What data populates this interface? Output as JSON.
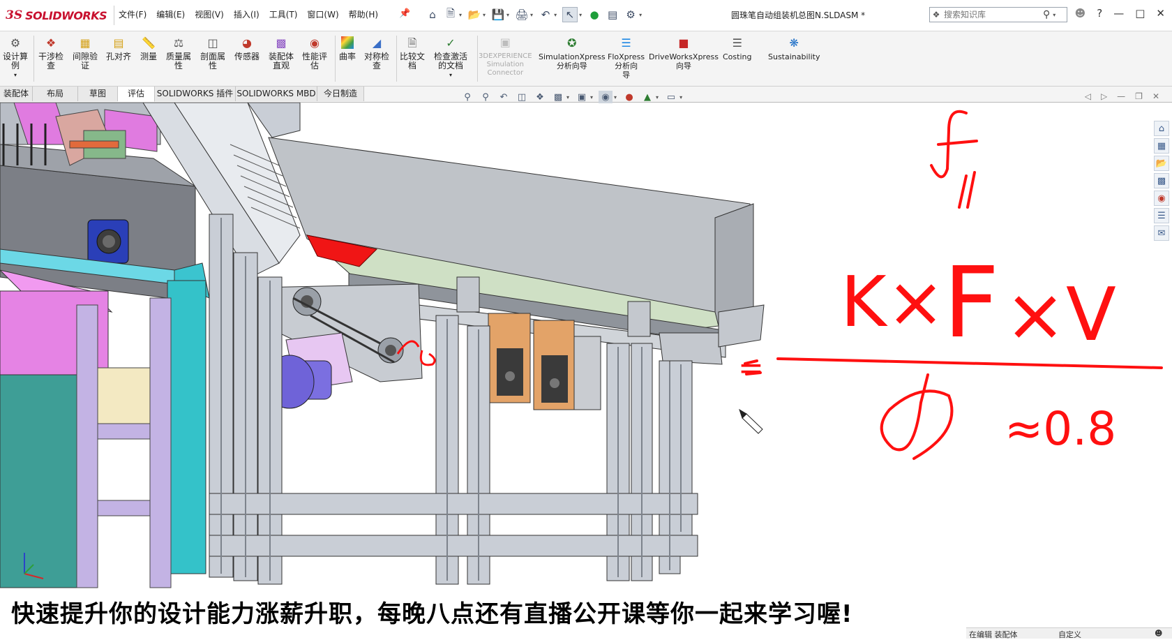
{
  "app": {
    "logo_prefix": "3S",
    "logo_name": "SOLIDWORKS",
    "menus": [
      "文件(F)",
      "编辑(E)",
      "视图(V)",
      "插入(I)",
      "工具(T)",
      "窗口(W)",
      "帮助(H)"
    ],
    "document_title": "圆珠笔自动组装机总图N.SLDASM *",
    "search_placeholder": "搜索知识库",
    "help_label": "?"
  },
  "command_manager": [
    {
      "label_1": "设计算",
      "label_2": "例",
      "icon": "design-study-icon"
    },
    {
      "label_1": "干涉检",
      "label_2": "查",
      "icon": "interference-icon"
    },
    {
      "label_1": "间隙验",
      "label_2": "证",
      "icon": "clearance-icon"
    },
    {
      "label_1": "孔对齐",
      "label_2": "",
      "icon": "hole-align-icon"
    },
    {
      "label_1": "测量",
      "label_2": "",
      "icon": "measure-icon"
    },
    {
      "label_1": "质量属",
      "label_2": "性",
      "icon": "mass-icon"
    },
    {
      "label_1": "剖面属",
      "label_2": "性",
      "icon": "section-icon"
    },
    {
      "label_1": "传感器",
      "label_2": "",
      "icon": "sensor-icon"
    },
    {
      "label_1": "装配体",
      "label_2": "直观",
      "icon": "assembly-visual-icon"
    },
    {
      "label_1": "性能评",
      "label_2": "估",
      "icon": "performance-icon"
    },
    {
      "label_1": "曲率",
      "label_2": "",
      "icon": "curvature-icon"
    },
    {
      "label_1": "对称检",
      "label_2": "查",
      "icon": "symmetry-icon"
    },
    {
      "label_1": "比较文",
      "label_2": "档",
      "icon": "compare-icon"
    },
    {
      "label_1": "检查激活",
      "label_2": "的文档",
      "icon": "check-doc-icon"
    },
    {
      "label_1": "3DEXPERIENCE",
      "label_2": "Simulation",
      "label_3": "Connector",
      "icon": "3dx-icon"
    },
    {
      "label_1": "SimulationXpress",
      "label_2": "分析向导",
      "icon": "simxpress-icon"
    },
    {
      "label_1": "FloXpress",
      "label_2": "分析向",
      "label_3": "导",
      "icon": "floxpress-icon"
    },
    {
      "label_1": "DriveWorksXpress",
      "label_2": "向导",
      "icon": "driveworks-icon"
    },
    {
      "label_1": "Costing",
      "label_2": "",
      "icon": "costing-icon"
    },
    {
      "label_1": "Sustainability",
      "label_2": "",
      "icon": "sustainability-icon"
    }
  ],
  "tabs": [
    "装配体",
    "布局",
    "草图",
    "评估",
    "SOLIDWORKS 插件",
    "SOLIDWORKS MBD",
    "今日制造"
  ],
  "active_tab": "评估",
  "annotation": {
    "numerator_left": "K×",
    "numerator_mid": "F",
    "numerator_right": "×V",
    "top_symbol": "f",
    "equals": "=",
    "denominator": "η",
    "denominator_value": "≈0.8"
  },
  "caption": "快速提升你的设计能力涨薪升职，每晚八点还有直播公开课等你一起来学习喔!",
  "status": {
    "left": "在编辑 装配体",
    "right": "自定义"
  },
  "colors": {
    "accent": "#c8102e",
    "annotation_red": "#ff1010",
    "frame_gray": "#c9ced6",
    "belt_green": "#cfe0c5"
  }
}
